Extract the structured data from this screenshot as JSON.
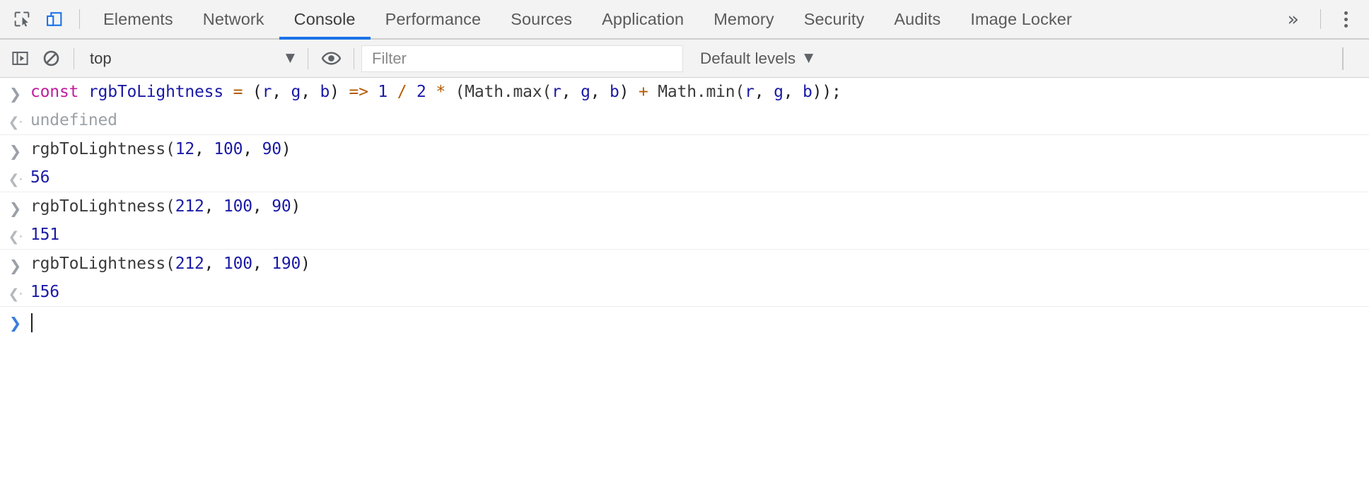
{
  "colors": {
    "accent": "#1a73e8",
    "toolbar_bg": "#f3f3f3",
    "body_bg": "#ffffff",
    "keyword": "#c01c9b",
    "identifier": "#1a1aa6",
    "operator": "#b35b00",
    "number": "#1a1aa6",
    "undefined_gray": "#9aa0a6",
    "prompt_blue": "#3b7ddd"
  },
  "tabbar": {
    "icons": [
      {
        "name": "inspect-element-icon",
        "label": "Inspect element"
      },
      {
        "name": "device-toolbar-icon",
        "label": "Toggle device toolbar"
      }
    ],
    "tabs": [
      {
        "label": "Elements",
        "active": false
      },
      {
        "label": "Network",
        "active": false
      },
      {
        "label": "Console",
        "active": true
      },
      {
        "label": "Performance",
        "active": false
      },
      {
        "label": "Sources",
        "active": false
      },
      {
        "label": "Application",
        "active": false
      },
      {
        "label": "Memory",
        "active": false
      },
      {
        "label": "Security",
        "active": false
      },
      {
        "label": "Audits",
        "active": false
      },
      {
        "label": "Image Locker",
        "active": false
      }
    ],
    "overflow_label": "»",
    "menu_label": "More options"
  },
  "console_toolbar": {
    "sidebar_toggle": "Show console sidebar",
    "clear_label": "Clear console",
    "context": {
      "selected": "top",
      "caret": "▼"
    },
    "eye_label": "Create live expression",
    "filter": {
      "value": "",
      "placeholder": "Filter"
    },
    "levels": {
      "label": "Default levels",
      "caret": "▼"
    }
  },
  "console": {
    "prompt_in": "❯",
    "prompt_out": "‹·",
    "groups": [
      {
        "input_tokens": [
          {
            "t": "const",
            "c": "tok-kw"
          },
          {
            "t": " ",
            "c": "tok-plain"
          },
          {
            "t": "rgbToLightness",
            "c": "tok-name"
          },
          {
            "t": " ",
            "c": "tok-plain"
          },
          {
            "t": "=",
            "c": "tok-op"
          },
          {
            "t": " (",
            "c": "tok-plain"
          },
          {
            "t": "r",
            "c": "tok-name"
          },
          {
            "t": ", ",
            "c": "tok-plain"
          },
          {
            "t": "g",
            "c": "tok-name"
          },
          {
            "t": ", ",
            "c": "tok-plain"
          },
          {
            "t": "b",
            "c": "tok-name"
          },
          {
            "t": ") ",
            "c": "tok-plain"
          },
          {
            "t": "=>",
            "c": "tok-op"
          },
          {
            "t": " ",
            "c": "tok-plain"
          },
          {
            "t": "1",
            "c": "tok-num"
          },
          {
            "t": " ",
            "c": "tok-plain"
          },
          {
            "t": "/",
            "c": "tok-op"
          },
          {
            "t": " ",
            "c": "tok-plain"
          },
          {
            "t": "2",
            "c": "tok-num"
          },
          {
            "t": " ",
            "c": "tok-plain"
          },
          {
            "t": "*",
            "c": "tok-op"
          },
          {
            "t": " (Math.max(",
            "c": "tok-ident"
          },
          {
            "t": "r",
            "c": "tok-name"
          },
          {
            "t": ", ",
            "c": "tok-plain"
          },
          {
            "t": "g",
            "c": "tok-name"
          },
          {
            "t": ", ",
            "c": "tok-plain"
          },
          {
            "t": "b",
            "c": "tok-name"
          },
          {
            "t": ") ",
            "c": "tok-plain"
          },
          {
            "t": "+",
            "c": "tok-op"
          },
          {
            "t": " Math.min(",
            "c": "tok-ident"
          },
          {
            "t": "r",
            "c": "tok-name"
          },
          {
            "t": ", ",
            "c": "tok-plain"
          },
          {
            "t": "g",
            "c": "tok-name"
          },
          {
            "t": ", ",
            "c": "tok-plain"
          },
          {
            "t": "b",
            "c": "tok-name"
          },
          {
            "t": "));",
            "c": "tok-plain"
          }
        ],
        "input_text": "const rgbToLightness = (r, g, b) => 1 / 2 * (Math.max(r, g, b) + Math.min(r, g, b));",
        "output_tokens": [
          {
            "t": "undefined",
            "c": "out-undef"
          }
        ],
        "output_text": "undefined"
      },
      {
        "input_tokens": [
          {
            "t": "rgbToLightness(",
            "c": "tok-ident"
          },
          {
            "t": "12",
            "c": "tok-num"
          },
          {
            "t": ", ",
            "c": "tok-plain"
          },
          {
            "t": "100",
            "c": "tok-num"
          },
          {
            "t": ", ",
            "c": "tok-plain"
          },
          {
            "t": "90",
            "c": "tok-num"
          },
          {
            "t": ")",
            "c": "tok-plain"
          }
        ],
        "input_text": "rgbToLightness(12, 100, 90)",
        "output_tokens": [
          {
            "t": "56",
            "c": "out-num"
          }
        ],
        "output_text": "56"
      },
      {
        "input_tokens": [
          {
            "t": "rgbToLightness(",
            "c": "tok-ident"
          },
          {
            "t": "212",
            "c": "tok-num"
          },
          {
            "t": ", ",
            "c": "tok-plain"
          },
          {
            "t": "100",
            "c": "tok-num"
          },
          {
            "t": ", ",
            "c": "tok-plain"
          },
          {
            "t": "90",
            "c": "tok-num"
          },
          {
            "t": ")",
            "c": "tok-plain"
          }
        ],
        "input_text": "rgbToLightness(212, 100, 90)",
        "output_tokens": [
          {
            "t": "151",
            "c": "out-num"
          }
        ],
        "output_text": "151"
      },
      {
        "input_tokens": [
          {
            "t": "rgbToLightness(",
            "c": "tok-ident"
          },
          {
            "t": "212",
            "c": "tok-num"
          },
          {
            "t": ", ",
            "c": "tok-plain"
          },
          {
            "t": "100",
            "c": "tok-num"
          },
          {
            "t": ", ",
            "c": "tok-plain"
          },
          {
            "t": "190",
            "c": "tok-num"
          },
          {
            "t": ")",
            "c": "tok-plain"
          }
        ],
        "input_text": "rgbToLightness(212, 100, 190)",
        "output_tokens": [
          {
            "t": "156",
            "c": "out-num"
          }
        ],
        "output_text": "156"
      }
    ],
    "active_prompt": {
      "value": ""
    }
  }
}
